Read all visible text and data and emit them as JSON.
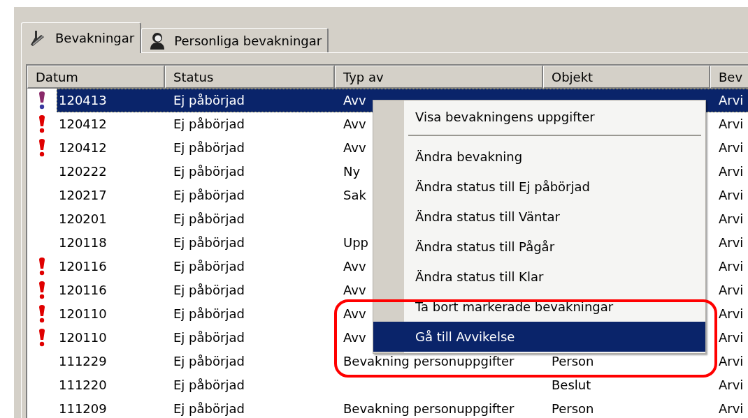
{
  "tabs": [
    {
      "label": "Bevakningar",
      "selected": true
    },
    {
      "label": "Personliga bevakningar",
      "selected": false
    }
  ],
  "table": {
    "columns": [
      "Datum",
      "Status",
      "Typ av",
      "Objekt",
      "Bev"
    ],
    "rows": [
      {
        "flagged": true,
        "selected": true,
        "cells": [
          "120413",
          "Ej påbörjad",
          "Avv",
          "",
          "Arvi"
        ]
      },
      {
        "flagged": true,
        "selected": false,
        "cells": [
          "120412",
          "Ej påbörjad",
          "Avv",
          "",
          "Arvi"
        ]
      },
      {
        "flagged": true,
        "selected": false,
        "cells": [
          "120412",
          "Ej påbörjad",
          "Avv",
          "",
          "Arvi"
        ]
      },
      {
        "flagged": false,
        "selected": false,
        "cells": [
          "120222",
          "Ej påbörjad",
          "Ny",
          "",
          "Arvi"
        ]
      },
      {
        "flagged": false,
        "selected": false,
        "cells": [
          "120217",
          "Ej påbörjad",
          "Sak",
          "",
          "Arvi"
        ]
      },
      {
        "flagged": false,
        "selected": false,
        "cells": [
          "120201",
          "Ej påbörjad",
          "",
          "",
          "Arvi"
        ]
      },
      {
        "flagged": false,
        "selected": false,
        "cells": [
          "120118",
          "Ej påbörjad",
          "Upp",
          "",
          "Arvi"
        ]
      },
      {
        "flagged": true,
        "selected": false,
        "cells": [
          "120116",
          "Ej påbörjad",
          "Avv",
          "",
          "Arvi"
        ]
      },
      {
        "flagged": true,
        "selected": false,
        "cells": [
          "120116",
          "Ej påbörjad",
          "Avv",
          "",
          "Arvi"
        ]
      },
      {
        "flagged": true,
        "selected": false,
        "cells": [
          "120110",
          "Ej påbörjad",
          "Avv",
          "",
          "Arvi"
        ]
      },
      {
        "flagged": true,
        "selected": false,
        "cells": [
          "120110",
          "Ej påbörjad",
          "Avv",
          "",
          "Arvi"
        ]
      },
      {
        "flagged": false,
        "selected": false,
        "cells": [
          "111229",
          "Ej påbörjad",
          "Bevakning personuppgifter",
          "Person",
          "Arvi"
        ]
      },
      {
        "flagged": false,
        "selected": false,
        "cells": [
          "111220",
          "Ej påbörjad",
          "",
          "Beslut",
          "Arvi"
        ]
      },
      {
        "flagged": false,
        "selected": false,
        "cells": [
          "111209",
          "Ej påbörjad",
          "Bevakning personuppgifter",
          "Person",
          "Arvi"
        ]
      }
    ]
  },
  "context_menu": {
    "items": [
      {
        "kind": "item",
        "label": "Visa bevakningens uppgifter",
        "selected": false
      },
      {
        "kind": "separator"
      },
      {
        "kind": "item",
        "label": "Ändra bevakning",
        "selected": false
      },
      {
        "kind": "item",
        "label": "Ändra status till Ej påbörjad",
        "selected": false
      },
      {
        "kind": "item",
        "label": "Ändra status till Väntar",
        "selected": false
      },
      {
        "kind": "item",
        "label": "Ändra status till Pågår",
        "selected": false
      },
      {
        "kind": "item",
        "label": "Ändra status till Klar",
        "selected": false
      },
      {
        "kind": "item",
        "label": "Ta bort markerade bevakningar",
        "selected": false
      },
      {
        "kind": "item",
        "label": "Gå till Avvikelse",
        "selected": true
      }
    ]
  }
}
